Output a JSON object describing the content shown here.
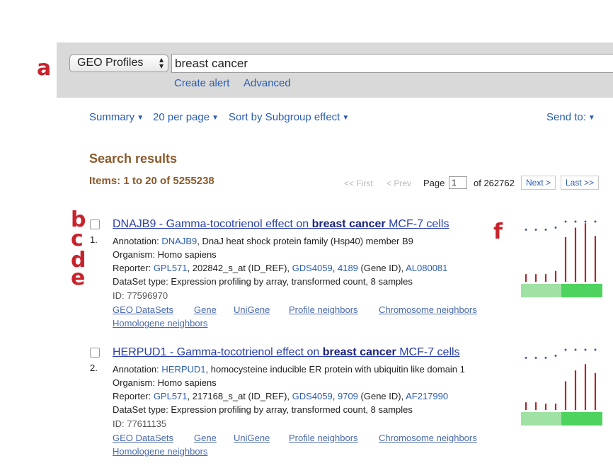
{
  "markers": {
    "a": "a",
    "b": "b",
    "c": "c",
    "d": "d",
    "e": "e",
    "f": "f"
  },
  "search": {
    "database": "GEO Profiles",
    "query": "breast cancer",
    "create_alert": "Create alert",
    "advanced": "Advanced"
  },
  "toolbar": {
    "summary": "Summary",
    "per_page": "20 per page",
    "sort": "Sort by Subgroup effect",
    "send_to": "Send to:"
  },
  "results": {
    "title": "Search results",
    "items": "Items: 1 to 20 of 5255238"
  },
  "pager": {
    "first": "<< First",
    "prev": "< Prev",
    "page_label": "Page",
    "page_value": "1",
    "of_total": "of 262762",
    "next": "Next >",
    "last": "Last >>"
  },
  "entries": [
    {
      "number": "1.",
      "title_pre": "DNAJB9 - Gamma-tocotrienol effect on ",
      "title_bold": "breast cancer",
      "title_post": " MCF-7 cells",
      "annotation_label": "Annotation: ",
      "annotation_gene": "DNAJB9",
      "annotation_desc": ", DnaJ heat shock protein family (Hsp40) member B9",
      "organism": "Organism: Homo sapiens",
      "reporter_label": "Reporter: ",
      "platform": "GPL571",
      "probe": ", 202842_s_at (ID_REF), ",
      "dataset": "GDS4059",
      "sep": ", ",
      "gene_id": "4189",
      "gene_id_label": " (Gene ID), ",
      "accession": "AL080081",
      "dataset_type": "DataSet type: Expression profiling by array, transformed count, 8 samples",
      "id": "ID: 77596970",
      "nav_links": [
        "GEO DataSets",
        "Gene",
        "UniGene",
        "Profile neighbors",
        "Chromosome neighbors",
        "Homologene neighbors"
      ],
      "bars": [
        0.12,
        0.12,
        0.12,
        0.17,
        0.7,
        0.85,
        0.92,
        0.72
      ],
      "ranks": [
        0.52,
        0.52,
        0.52,
        0.62,
        0.9,
        0.9,
        0.9,
        0.9
      ]
    },
    {
      "number": "2.",
      "title_pre": "HERPUD1 - Gamma-tocotrienol effect on ",
      "title_bold": "breast cancer",
      "title_post": " MCF-7 cells",
      "annotation_label": "Annotation: ",
      "annotation_gene": "HERPUD1",
      "annotation_desc": ", homocysteine inducible ER protein with ubiquitin like domain 1",
      "organism": "Organism: Homo sapiens",
      "reporter_label": "Reporter: ",
      "platform": "GPL571",
      "probe": ", 217168_s_at (ID_REF), ",
      "dataset": "GDS4059",
      "sep": ", ",
      "gene_id": "9709",
      "gene_id_label": " (Gene ID), ",
      "accession": "AF217990",
      "dataset_type": "DataSet type: Expression profiling by array, transformed count, 8 samples",
      "id": "ID: 77611135",
      "nav_links": [
        "GEO DataSets",
        "Gene",
        "UniGene",
        "Profile neighbors",
        "Chromosome neighbors",
        "Homologene neighbors"
      ],
      "bars": [
        0.12,
        0.12,
        0.1,
        0.1,
        0.45,
        0.62,
        0.72,
        0.58
      ],
      "ranks": [
        0.52,
        0.52,
        0.52,
        0.62,
        0.9,
        0.9,
        0.9,
        0.9
      ]
    }
  ],
  "colors": {
    "link": "#2a5db0",
    "title_link": "#2a3fa8",
    "heading_brown": "#8b5a2b",
    "marker_red": "#c8232c",
    "bar_red": "#b0282a",
    "group_light": "#9fe2a4",
    "group_dark": "#4fd35f",
    "dot_blue": "#3d5aa8",
    "search_bg": "#d9d9d9"
  }
}
